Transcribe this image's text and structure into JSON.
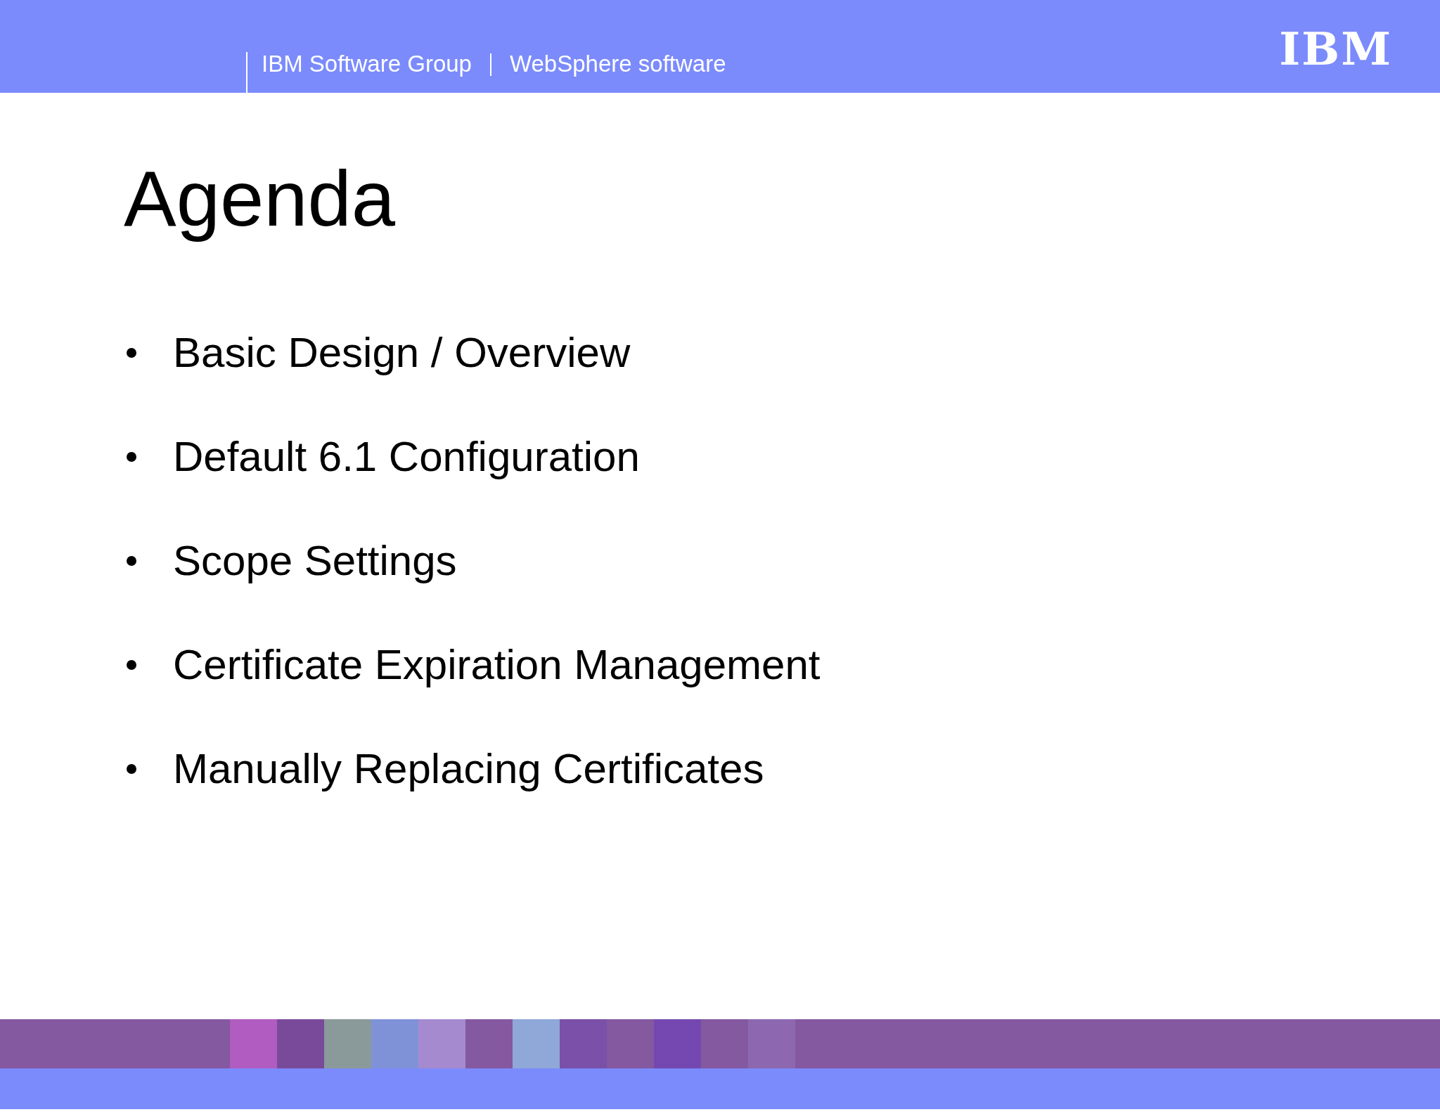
{
  "header": {
    "group": "IBM Software Group",
    "product": "WebSphere software",
    "logo": "IBM"
  },
  "title": "Agenda",
  "bullets": [
    "Basic Design / Overview",
    "Default 6.1 Configuration",
    "Scope Settings",
    "Certificate Expiration Management",
    "Manually Replacing Certificates"
  ]
}
